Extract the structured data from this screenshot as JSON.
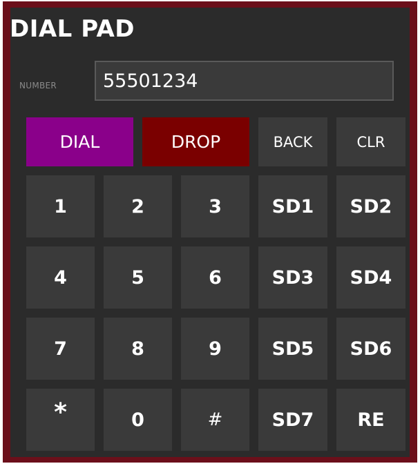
{
  "title": "DIAL PAD",
  "number": {
    "label": "NUMBER",
    "value": "55501234"
  },
  "actions": {
    "dial": "DIAL",
    "drop": "DROP",
    "back": "BACK",
    "clear": "CLR"
  },
  "keypad": {
    "row1": [
      "1",
      "2",
      "3",
      "SD1",
      "SD2"
    ],
    "row2": [
      "4",
      "5",
      "6",
      "SD3",
      "SD4"
    ],
    "row3": [
      "7",
      "8",
      "9",
      "SD5",
      "SD6"
    ],
    "row4": [
      "*",
      "0",
      "#",
      "SD7",
      "RE"
    ]
  },
  "colors": {
    "frame": "#6b0f1a",
    "panel": "#2b2b2b",
    "key": "#3a3a3a",
    "dial": "#8a008a",
    "drop": "#7a0000"
  }
}
